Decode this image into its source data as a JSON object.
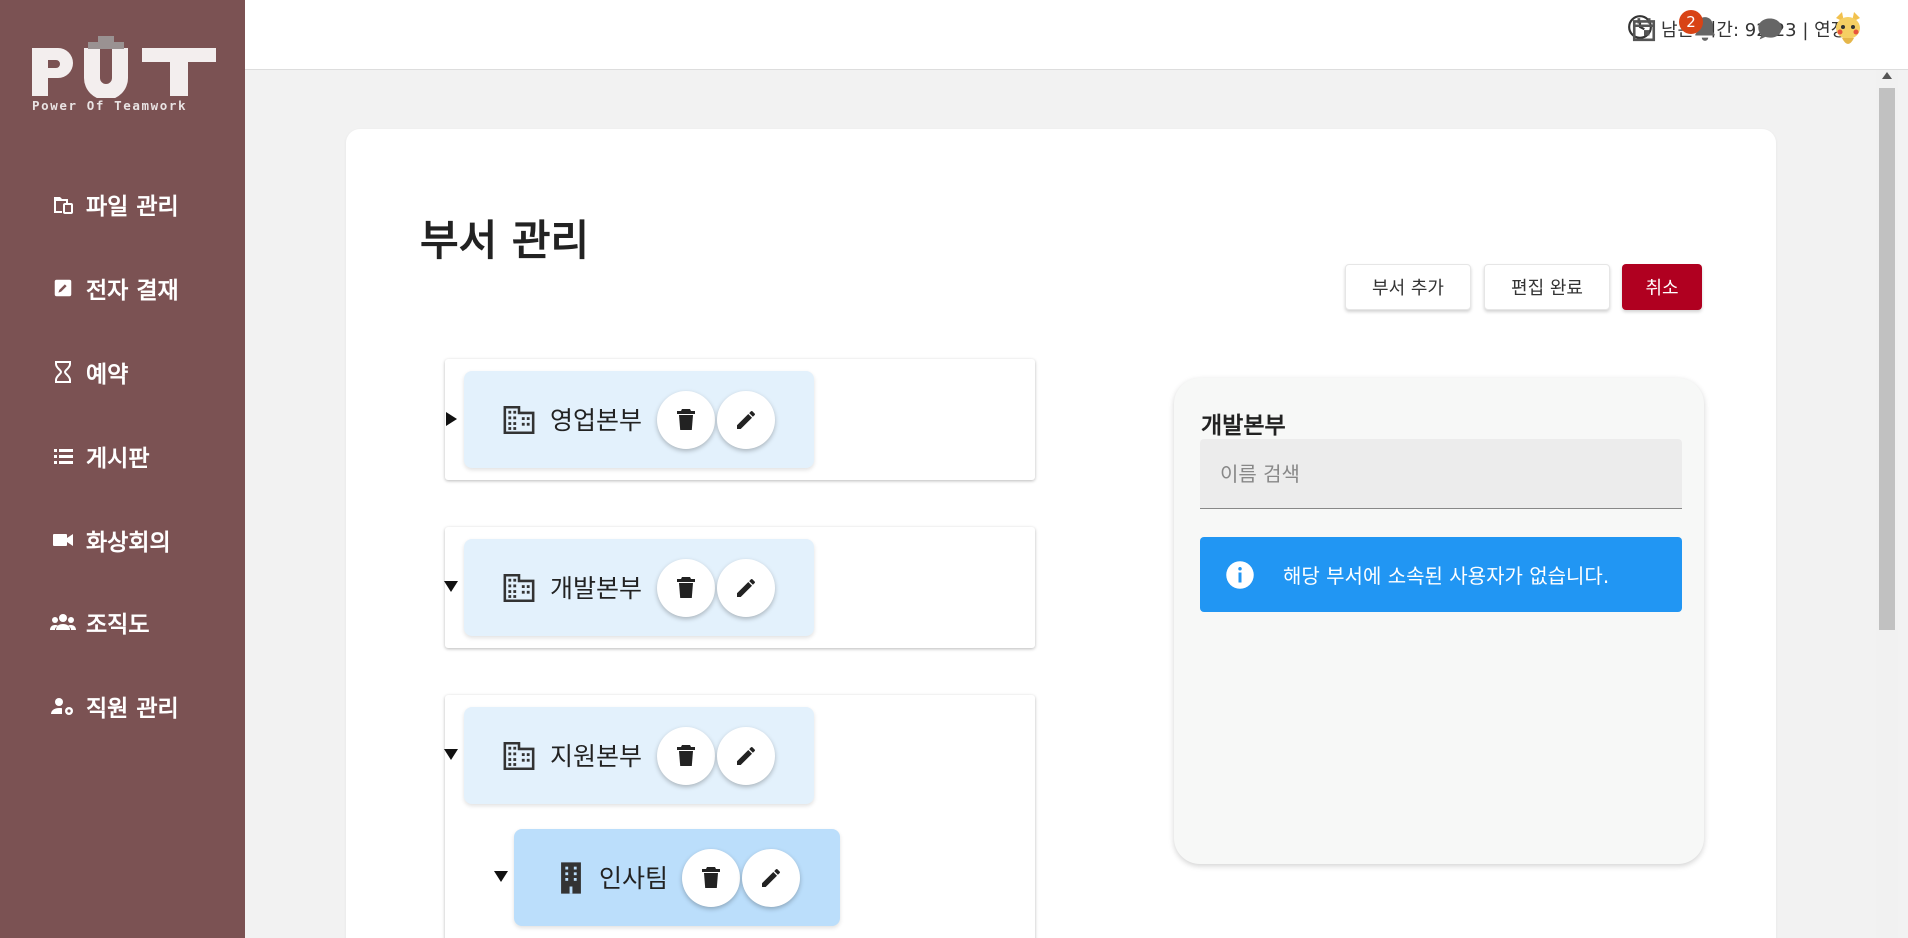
{
  "sidebar": {
    "logo": {
      "main": "PUT",
      "sub": "Power Of Teamwork"
    },
    "items": [
      {
        "label": "파일 관리",
        "icon": "file-folder-icon"
      },
      {
        "label": "전자 결재",
        "icon": "edit-document-icon"
      },
      {
        "label": "예약",
        "icon": "hourglass-icon"
      },
      {
        "label": "게시판",
        "icon": "list-icon"
      },
      {
        "label": "화상회의",
        "icon": "video-camera-icon"
      },
      {
        "label": "조직도",
        "icon": "group-icon"
      },
      {
        "label": "직원 관리",
        "icon": "user-settings-icon"
      }
    ],
    "background": "#7b5253"
  },
  "topbar": {
    "timer_text": "남은 시간: 92:23 | 연장",
    "notification_count": "2",
    "icons": [
      "clock-icon",
      "calendar-icon",
      "bell-icon",
      "chat-icon",
      "avatar"
    ]
  },
  "main": {
    "title": "부서 관리",
    "buttons": {
      "add": "부서 추가",
      "done": "편집 완료",
      "cancel": "취소"
    },
    "departments": [
      {
        "name": "영업본부",
        "expanded": false
      },
      {
        "name": "개발본부",
        "expanded": true
      },
      {
        "name": "지원본부",
        "expanded": true,
        "children": [
          {
            "name": "인사팀",
            "selected": true
          }
        ]
      }
    ]
  },
  "panel": {
    "title": "개발본부",
    "search_placeholder": "이름 검색",
    "alert": "해당 부서에 소속된 사용자가 없습니다."
  },
  "colors": {
    "accent_red": "#b00020",
    "info_blue": "#2196f3",
    "chip_bg": "#e3f1fc",
    "chip_selected_bg": "#bbdefb"
  }
}
